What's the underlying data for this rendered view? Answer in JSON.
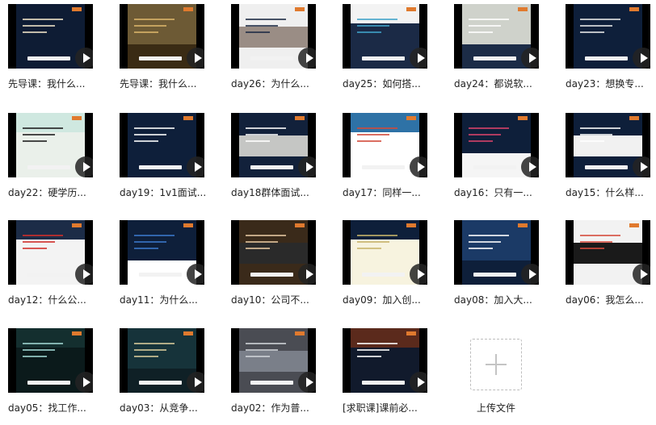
{
  "items": [
    {
      "label": "先导课：我什么...",
      "bg": "#0e1c34",
      "band": "#0e1c34",
      "accent": "#f0e3c8"
    },
    {
      "label": "先导课：我什么...",
      "bg": "#6d5a35",
      "band": "#3a2b14",
      "accent": "#d9b46a"
    },
    {
      "label": "day26：为什么...",
      "bg": "#efefef",
      "band": "#9a8d85",
      "accent": "#1d2a44"
    },
    {
      "label": "day25：如何搭...",
      "bg": "#1b2a46",
      "band": "#f3f3f3",
      "accent": "#40a2c8"
    },
    {
      "label": "day24：都说软...",
      "bg": "#cfd2cb",
      "band": "#1c2c47",
      "accent": "#ffffff"
    },
    {
      "label": "day23：想换专...",
      "bg": "#0e1f3a",
      "band": "#0e1f3a",
      "accent": "#e7e7e7"
    },
    {
      "label": "day22：硬学历...",
      "bg": "#eaf0ea",
      "band": "#cfe8e0",
      "accent": "#1e1e1e"
    },
    {
      "label": "day19：1v1面试...",
      "bg": "#0e1f3a",
      "band": "#0e1f3a",
      "accent": "#ffffff"
    },
    {
      "label": "day18群体面试...",
      "bg": "#12213b",
      "band": "#c5c6c4",
      "accent": "#ffffff"
    },
    {
      "label": "day17：同样一...",
      "bg": "#ffffff",
      "band": "#2e72a6",
      "accent": "#d24a3a"
    },
    {
      "label": "day16：只有一...",
      "bg": "#0e1f3a",
      "band": "#f5f5f5",
      "accent": "#d8426a"
    },
    {
      "label": "day15：什么样...",
      "bg": "#0e1f3a",
      "band": "#f1f1f1",
      "accent": "#ffffff"
    },
    {
      "label": "day12：什么公...",
      "bg": "#f3f3f3",
      "band": "#1c2c47",
      "accent": "#d1302b"
    },
    {
      "label": "day11：为什么...",
      "bg": "#0e1f3a",
      "band": "#ffffff",
      "accent": "#3b77c9"
    },
    {
      "label": "day10：公司不...",
      "bg": "#3a2a1a",
      "band": "#2a2a2a",
      "accent": "#e5c7a0"
    },
    {
      "label": "day09：加入创...",
      "bg": "#f7f3df",
      "band": "#0e1f3a",
      "accent": "#c8b46a"
    },
    {
      "label": "day08：加入大...",
      "bg": "#1b3a66",
      "band": "#0e1f3a",
      "accent": "#ffffff"
    },
    {
      "label": "day06：我怎么...",
      "bg": "#f2f2f2",
      "band": "#1a1a1a",
      "accent": "#d44b3c"
    },
    {
      "label": "day05：找工作...",
      "bg": "#0b1a1b",
      "band": "#142f2f",
      "accent": "#9fd4d1"
    },
    {
      "label": "day03：从竞争...",
      "bg": "#16333a",
      "band": "#0f2026",
      "accent": "#d7c99a"
    },
    {
      "label": "day02：作为普...",
      "bg": "#4a4c53",
      "band": "#7a7f89",
      "accent": "#d0d3d8"
    },
    {
      "label": "[求职课]课前必...",
      "bg": "#111a2c",
      "band": "#5b2a1c",
      "accent": "#ffffff"
    }
  ],
  "upload": {
    "label": "上传文件"
  },
  "icons": {
    "play": "play-icon",
    "upload": "plus-icon"
  }
}
